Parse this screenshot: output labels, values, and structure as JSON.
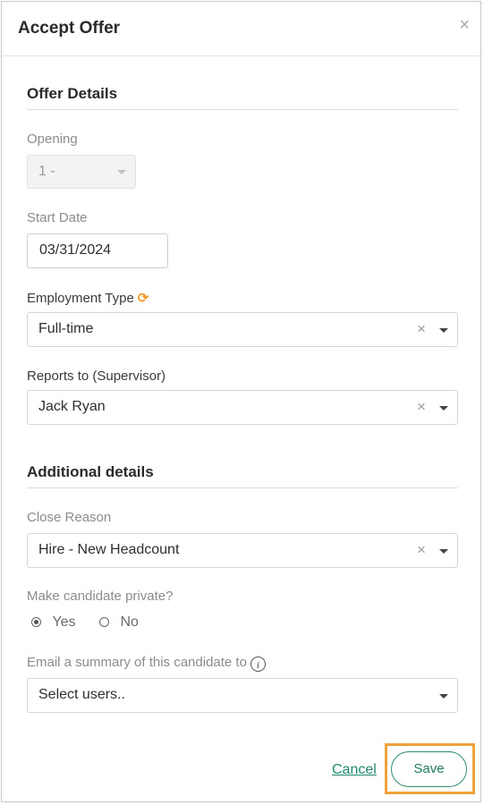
{
  "dialog": {
    "title": "Accept Offer",
    "close_glyph": "×"
  },
  "offer_details": {
    "heading": "Offer Details",
    "opening": {
      "label": "Opening",
      "value": "1 -"
    },
    "start_date": {
      "label": "Start Date",
      "value": "03/31/2024"
    },
    "employment_type": {
      "label": "Employment Type",
      "value": "Full-time",
      "refresh_icon": "refresh-icon"
    },
    "reports_to": {
      "label": "Reports to (Supervisor)",
      "value": "Jack Ryan"
    }
  },
  "additional_details": {
    "heading": "Additional details",
    "close_reason": {
      "label": "Close Reason",
      "value": "Hire - New Headcount"
    },
    "private": {
      "label": "Make candidate private?",
      "options": [
        "Yes",
        "No"
      ],
      "selected": "Yes"
    },
    "email_summary": {
      "label": "Email a summary of this candidate to",
      "placeholder": "Select users..",
      "info_glyph": "i"
    }
  },
  "footer": {
    "cancel_label": "Cancel",
    "save_label": "Save"
  },
  "colors": {
    "accent": "#2e8a72",
    "highlight": "#f0a23a",
    "refresh": "#f19a2a"
  }
}
